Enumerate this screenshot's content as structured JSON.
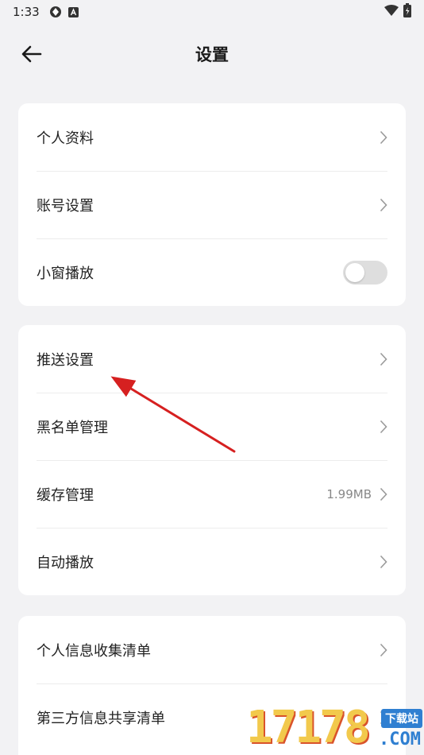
{
  "status_bar": {
    "time": "1:33",
    "icons": [
      "gear-icon",
      "a-icon"
    ],
    "right_icons": [
      "wifi-icon",
      "battery-icon"
    ]
  },
  "header": {
    "title": "设置",
    "back_icon": "arrow-left-icon"
  },
  "groups": [
    {
      "items": [
        {
          "label": "个人资料",
          "type": "link"
        },
        {
          "label": "账号设置",
          "type": "link"
        },
        {
          "label": "小窗播放",
          "type": "toggle",
          "on": false
        }
      ]
    },
    {
      "items": [
        {
          "label": "推送设置",
          "type": "link"
        },
        {
          "label": "黑名单管理",
          "type": "link"
        },
        {
          "label": "缓存管理",
          "type": "link",
          "value": "1.99MB"
        },
        {
          "label": "自动播放",
          "type": "link"
        }
      ]
    },
    {
      "items": [
        {
          "label": "个人信息收集清单",
          "type": "link"
        },
        {
          "label": "第三方信息共享清单",
          "type": "link"
        }
      ]
    }
  ],
  "annotation": {
    "arrow_color": "#d62020"
  },
  "watermark": {
    "digits": "17178",
    "tag": "下载站",
    "domain": ".COM"
  },
  "colors": {
    "background": "#f2f2f4",
    "card": "#ffffff",
    "text": "#222222",
    "secondary_text": "#888888",
    "toggle_off": "#dedede"
  }
}
